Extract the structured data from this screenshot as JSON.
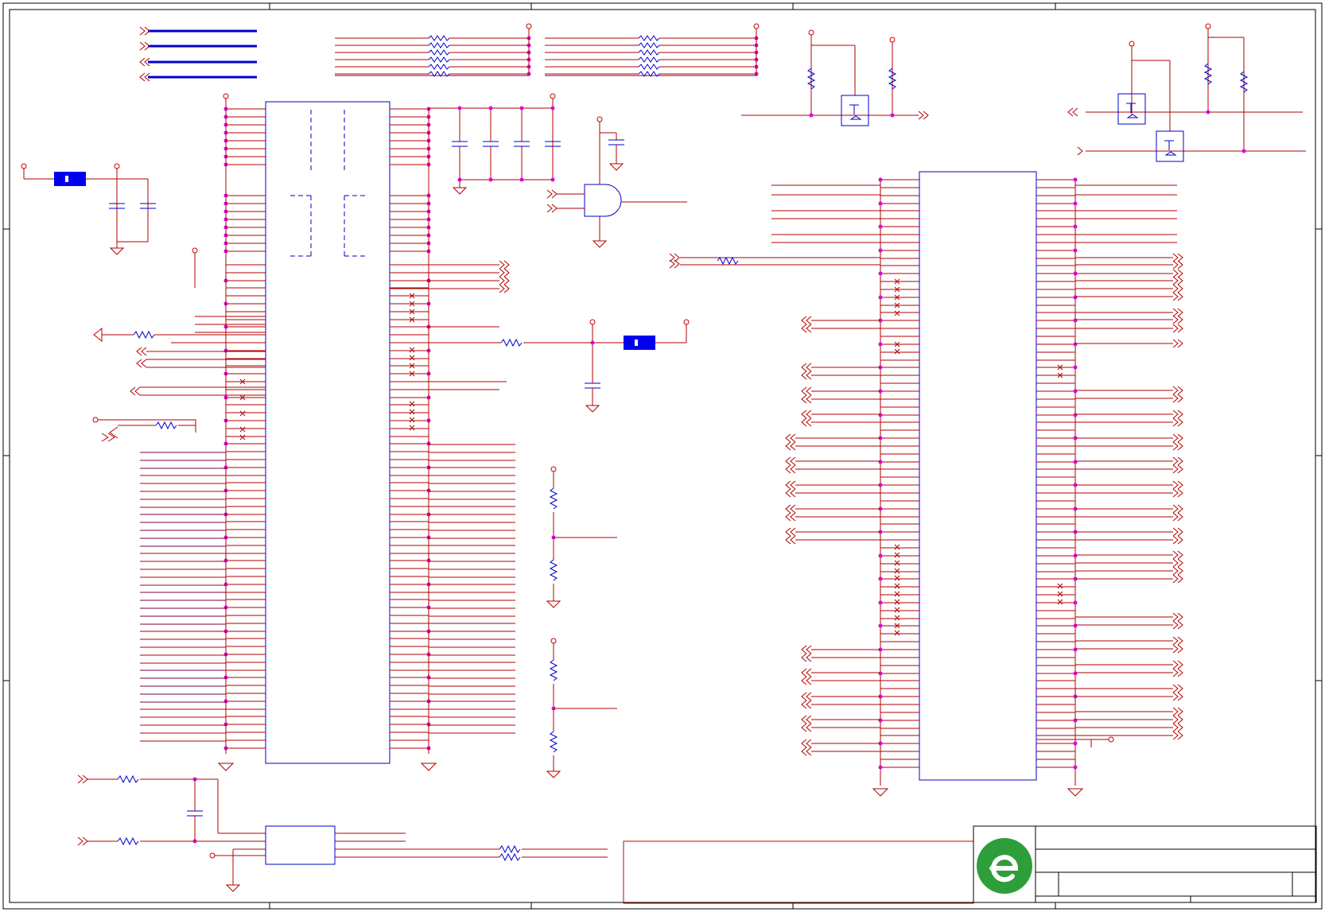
{
  "diagram": {
    "type": "electronic-schematic",
    "colors": {
      "wire": "#b00000",
      "component": "#0000cc",
      "junction": "#e000e0",
      "frame": "#000000",
      "logo": "#2e9e3a"
    },
    "icons": {
      "logo": "green-circle-e-logo",
      "ground": "ground-symbol",
      "power": "power-rail-circle",
      "offpage": "double-chevron-connector"
    },
    "text": []
  }
}
